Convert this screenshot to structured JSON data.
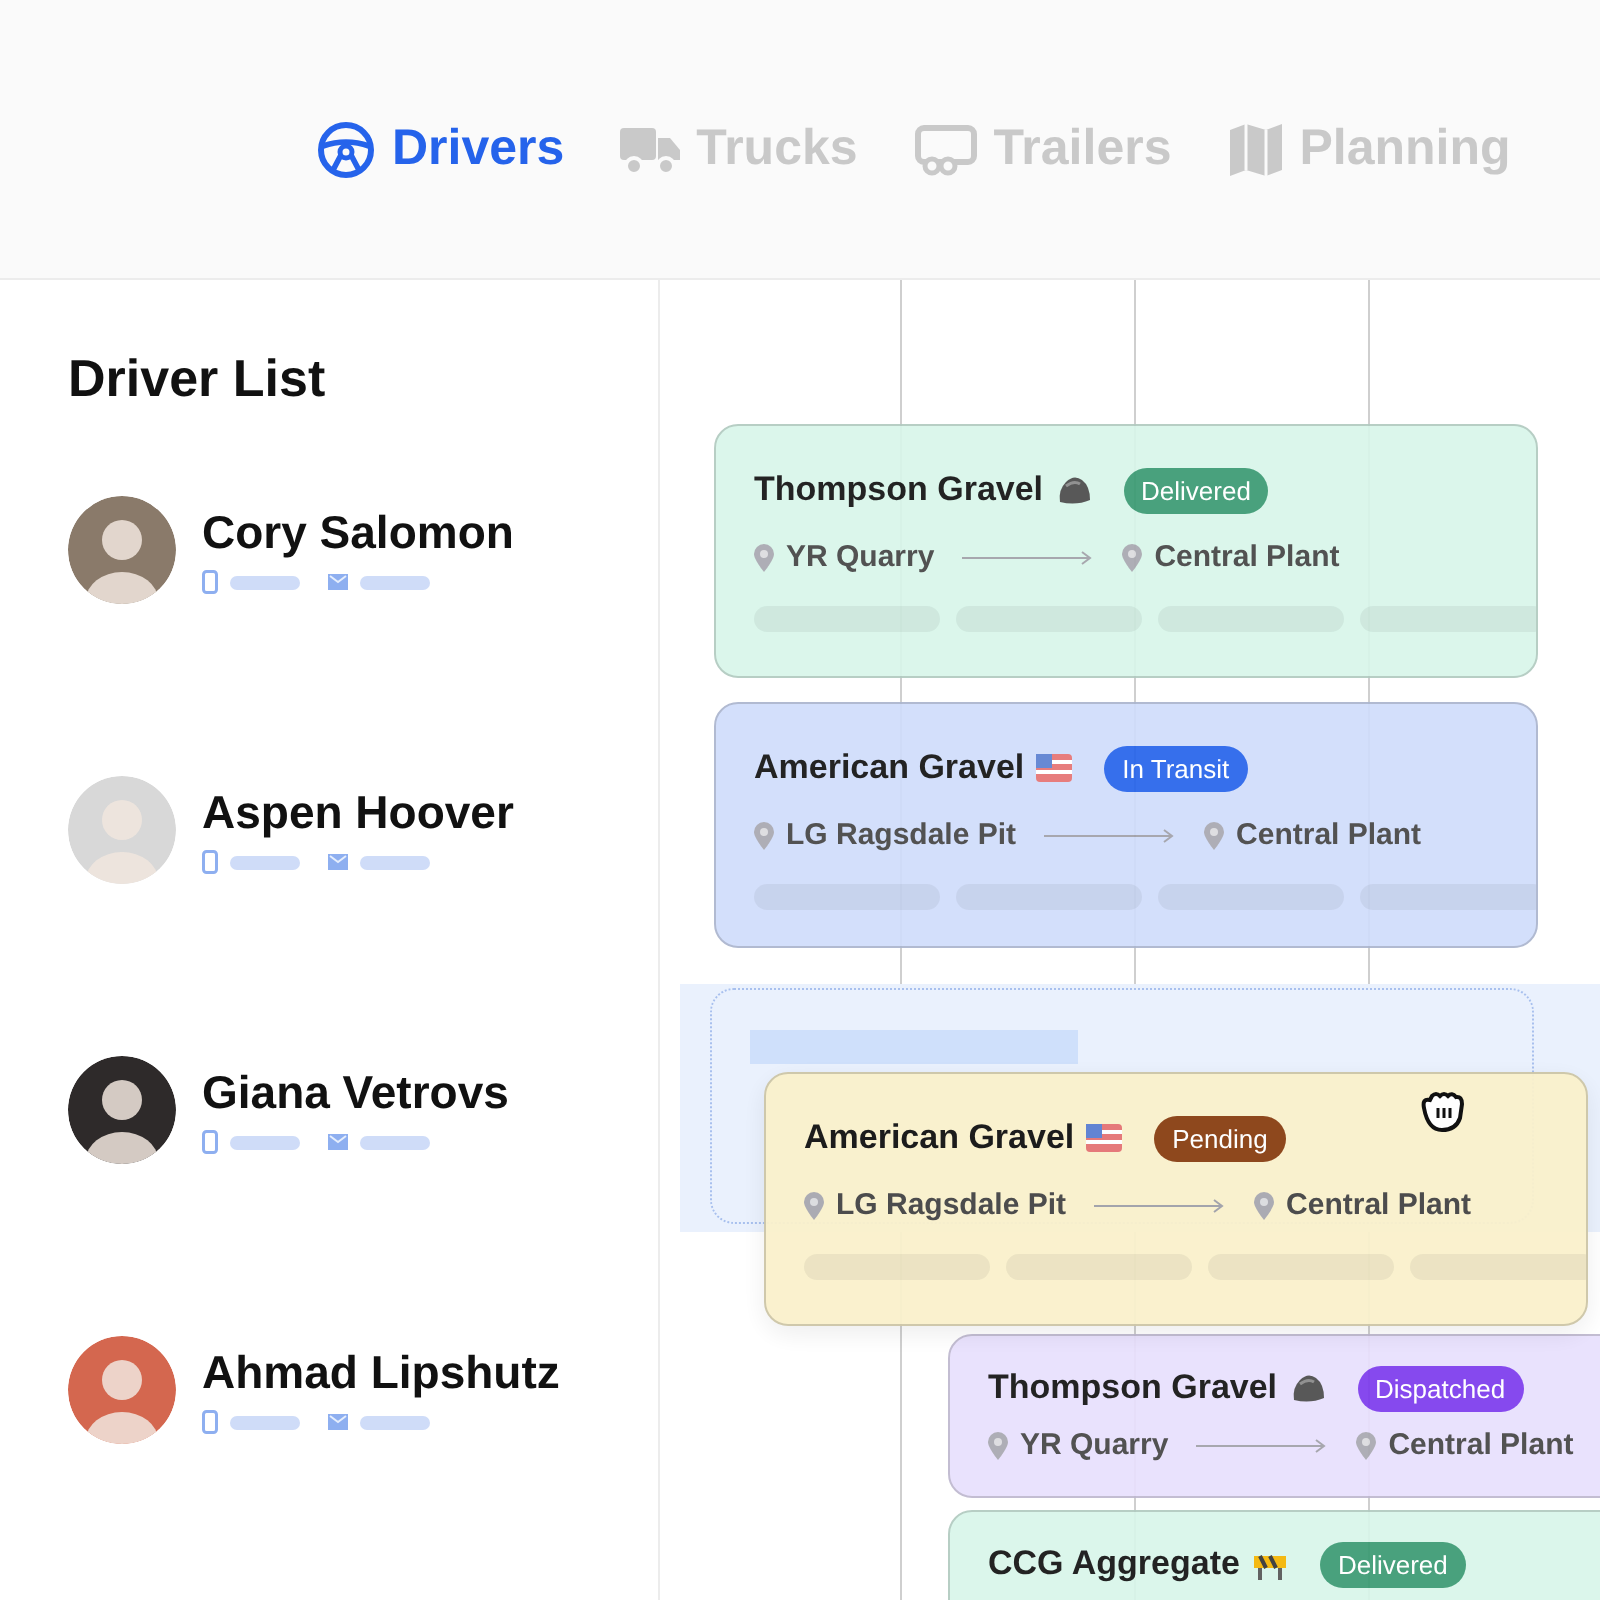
{
  "tabs": [
    {
      "label": "Drivers",
      "selected": true
    },
    {
      "label": "Trucks",
      "selected": false
    },
    {
      "label": "Trailers",
      "selected": false
    },
    {
      "label": "Planning",
      "selected": false
    }
  ],
  "driver_list": {
    "title": "Driver List",
    "drivers": [
      {
        "name": "Cory Salomon",
        "color": "#8a7a6a"
      },
      {
        "name": "Aspen Hoover",
        "color": "#d8d8d8"
      },
      {
        "name": "Giana Vetrovs",
        "color": "#2e2a2a"
      },
      {
        "name": "Ahmad Lipshutz",
        "color": "#d4674f"
      }
    ]
  },
  "loads": [
    {
      "title": "Thompson Gravel",
      "status": {
        "label": "Delivered",
        "color": "#3a9a72"
      },
      "from": "YR Quarry",
      "to": "Central Plant",
      "color": "#d8f6ea"
    },
    {
      "title": "American Gravel",
      "status": {
        "label": "In Transit",
        "color": "#2563eb"
      },
      "from": "LG Ragsdale Pit",
      "to": "Central Plant",
      "color": "#d0ddfb"
    },
    {
      "title": "Thompson Gravel",
      "status": {
        "label": "Dispatched",
        "color": "#7c3aed"
      },
      "from": "YR Quarry",
      "to": "Central Plant",
      "color": "#e8e0fd"
    },
    {
      "title": "CCG Aggregate",
      "status": {
        "label": "Delivered",
        "color": "#3a9a72"
      },
      "color": "#d8f6ea"
    }
  ],
  "dragged_load": {
    "title": "American Gravel",
    "status": {
      "label": "Pending",
      "color": "#8a3f12"
    },
    "from": "LG Ragsdale Pit",
    "to": "Central Plant",
    "color": "#faf1cc"
  }
}
